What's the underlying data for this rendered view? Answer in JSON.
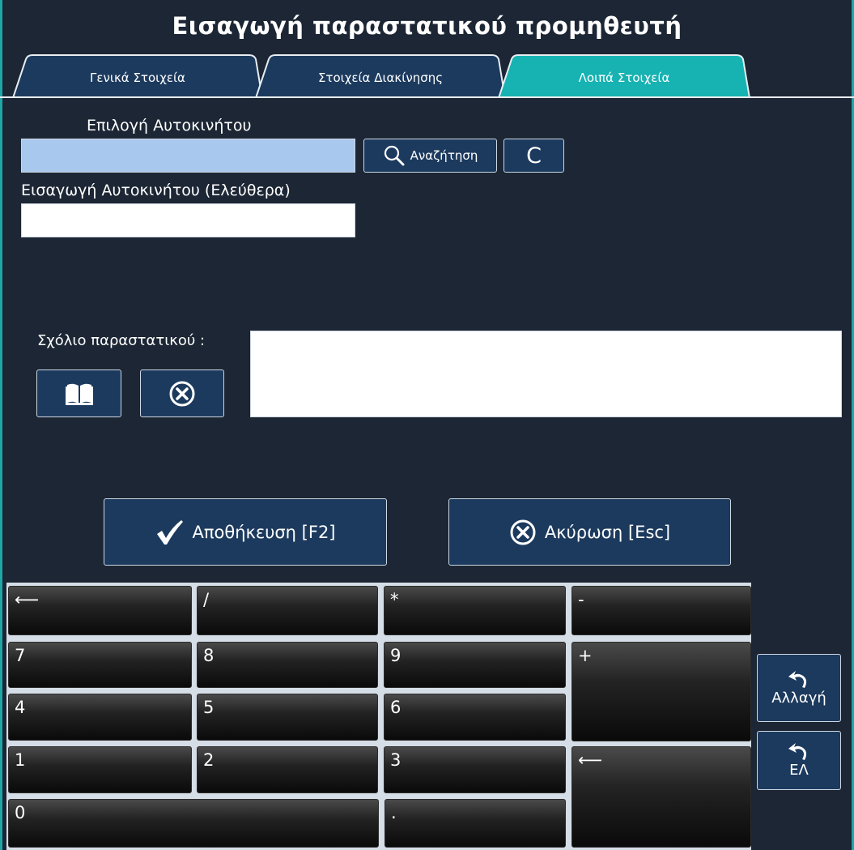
{
  "window": {
    "title": "Εισαγωγή παραστατικού προμηθευτή"
  },
  "tabs": [
    {
      "label": "Γενικά Στοιχεία",
      "active": false
    },
    {
      "label": "Στοιχεία Διακίνησης",
      "active": false
    },
    {
      "label": "Λοιπά Στοιχεία",
      "active": true
    }
  ],
  "vehicle": {
    "select_label": "Επιλογή Αυτοκινήτου",
    "select_value": "",
    "search_label": "Αναζήτηση",
    "clear_label": "C",
    "free_label": "Εισαγωγή Αυτοκινήτου (Ελεύθερα)",
    "free_value": ""
  },
  "comment": {
    "label": "Σχόλιο παραστατικού :",
    "value": "",
    "book_icon": "book-icon",
    "clear_icon": "circle-x-icon"
  },
  "actions": {
    "save_label": "Αποθήκευση [F2]",
    "cancel_label": "Ακύρωση [Esc]"
  },
  "keypad": {
    "backspace": "⟵",
    "divide": "/",
    "multiply": "*",
    "minus": "-",
    "k7": "7",
    "k8": "8",
    "k9": "9",
    "plus": "+",
    "k4": "4",
    "k5": "5",
    "k6": "6",
    "k1": "1",
    "k2": "2",
    "k3": "3",
    "enter": "⟵",
    "k0": "0",
    "dot": "."
  },
  "side": {
    "change_label": "Αλλαγή",
    "lang_label": "ΕΛ"
  },
  "colors": {
    "background": "#1c2634",
    "tab": "#1c3a5e",
    "tab_active": "#17b2b2",
    "button": "#1c3a5e",
    "input_selected": "#a8c8ee",
    "border": "#1fa6a6"
  }
}
